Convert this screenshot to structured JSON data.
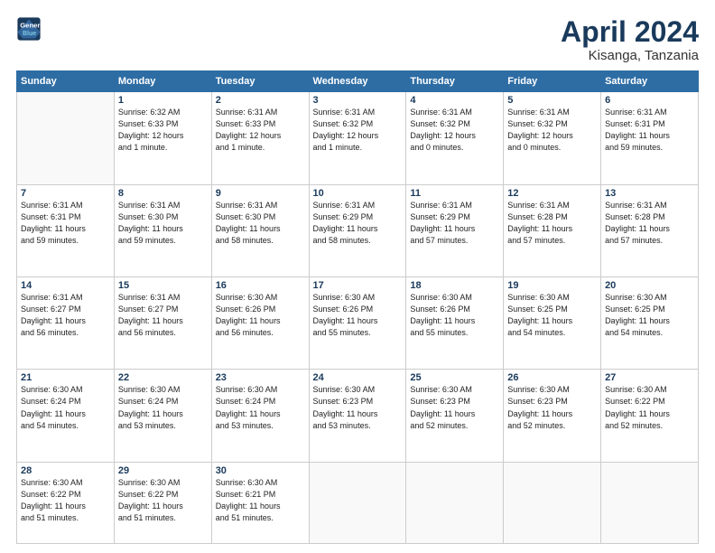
{
  "header": {
    "logo_line1": "General",
    "logo_line2": "Blue",
    "title": "April 2024",
    "subtitle": "Kisanga, Tanzania"
  },
  "columns": [
    "Sunday",
    "Monday",
    "Tuesday",
    "Wednesday",
    "Thursday",
    "Friday",
    "Saturday"
  ],
  "weeks": [
    [
      {
        "day": "",
        "info": ""
      },
      {
        "day": "1",
        "info": "Sunrise: 6:32 AM\nSunset: 6:33 PM\nDaylight: 12 hours\nand 1 minute."
      },
      {
        "day": "2",
        "info": "Sunrise: 6:31 AM\nSunset: 6:33 PM\nDaylight: 12 hours\nand 1 minute."
      },
      {
        "day": "3",
        "info": "Sunrise: 6:31 AM\nSunset: 6:32 PM\nDaylight: 12 hours\nand 1 minute."
      },
      {
        "day": "4",
        "info": "Sunrise: 6:31 AM\nSunset: 6:32 PM\nDaylight: 12 hours\nand 0 minutes."
      },
      {
        "day": "5",
        "info": "Sunrise: 6:31 AM\nSunset: 6:32 PM\nDaylight: 12 hours\nand 0 minutes."
      },
      {
        "day": "6",
        "info": "Sunrise: 6:31 AM\nSunset: 6:31 PM\nDaylight: 11 hours\nand 59 minutes."
      }
    ],
    [
      {
        "day": "7",
        "info": "Sunrise: 6:31 AM\nSunset: 6:31 PM\nDaylight: 11 hours\nand 59 minutes."
      },
      {
        "day": "8",
        "info": "Sunrise: 6:31 AM\nSunset: 6:30 PM\nDaylight: 11 hours\nand 59 minutes."
      },
      {
        "day": "9",
        "info": "Sunrise: 6:31 AM\nSunset: 6:30 PM\nDaylight: 11 hours\nand 58 minutes."
      },
      {
        "day": "10",
        "info": "Sunrise: 6:31 AM\nSunset: 6:29 PM\nDaylight: 11 hours\nand 58 minutes."
      },
      {
        "day": "11",
        "info": "Sunrise: 6:31 AM\nSunset: 6:29 PM\nDaylight: 11 hours\nand 57 minutes."
      },
      {
        "day": "12",
        "info": "Sunrise: 6:31 AM\nSunset: 6:28 PM\nDaylight: 11 hours\nand 57 minutes."
      },
      {
        "day": "13",
        "info": "Sunrise: 6:31 AM\nSunset: 6:28 PM\nDaylight: 11 hours\nand 57 minutes."
      }
    ],
    [
      {
        "day": "14",
        "info": "Sunrise: 6:31 AM\nSunset: 6:27 PM\nDaylight: 11 hours\nand 56 minutes."
      },
      {
        "day": "15",
        "info": "Sunrise: 6:31 AM\nSunset: 6:27 PM\nDaylight: 11 hours\nand 56 minutes."
      },
      {
        "day": "16",
        "info": "Sunrise: 6:30 AM\nSunset: 6:26 PM\nDaylight: 11 hours\nand 56 minutes."
      },
      {
        "day": "17",
        "info": "Sunrise: 6:30 AM\nSunset: 6:26 PM\nDaylight: 11 hours\nand 55 minutes."
      },
      {
        "day": "18",
        "info": "Sunrise: 6:30 AM\nSunset: 6:26 PM\nDaylight: 11 hours\nand 55 minutes."
      },
      {
        "day": "19",
        "info": "Sunrise: 6:30 AM\nSunset: 6:25 PM\nDaylight: 11 hours\nand 54 minutes."
      },
      {
        "day": "20",
        "info": "Sunrise: 6:30 AM\nSunset: 6:25 PM\nDaylight: 11 hours\nand 54 minutes."
      }
    ],
    [
      {
        "day": "21",
        "info": "Sunrise: 6:30 AM\nSunset: 6:24 PM\nDaylight: 11 hours\nand 54 minutes."
      },
      {
        "day": "22",
        "info": "Sunrise: 6:30 AM\nSunset: 6:24 PM\nDaylight: 11 hours\nand 53 minutes."
      },
      {
        "day": "23",
        "info": "Sunrise: 6:30 AM\nSunset: 6:24 PM\nDaylight: 11 hours\nand 53 minutes."
      },
      {
        "day": "24",
        "info": "Sunrise: 6:30 AM\nSunset: 6:23 PM\nDaylight: 11 hours\nand 53 minutes."
      },
      {
        "day": "25",
        "info": "Sunrise: 6:30 AM\nSunset: 6:23 PM\nDaylight: 11 hours\nand 52 minutes."
      },
      {
        "day": "26",
        "info": "Sunrise: 6:30 AM\nSunset: 6:23 PM\nDaylight: 11 hours\nand 52 minutes."
      },
      {
        "day": "27",
        "info": "Sunrise: 6:30 AM\nSunset: 6:22 PM\nDaylight: 11 hours\nand 52 minutes."
      }
    ],
    [
      {
        "day": "28",
        "info": "Sunrise: 6:30 AM\nSunset: 6:22 PM\nDaylight: 11 hours\nand 51 minutes."
      },
      {
        "day": "29",
        "info": "Sunrise: 6:30 AM\nSunset: 6:22 PM\nDaylight: 11 hours\nand 51 minutes."
      },
      {
        "day": "30",
        "info": "Sunrise: 6:30 AM\nSunset: 6:21 PM\nDaylight: 11 hours\nand 51 minutes."
      },
      {
        "day": "",
        "info": ""
      },
      {
        "day": "",
        "info": ""
      },
      {
        "day": "",
        "info": ""
      },
      {
        "day": "",
        "info": ""
      }
    ]
  ]
}
